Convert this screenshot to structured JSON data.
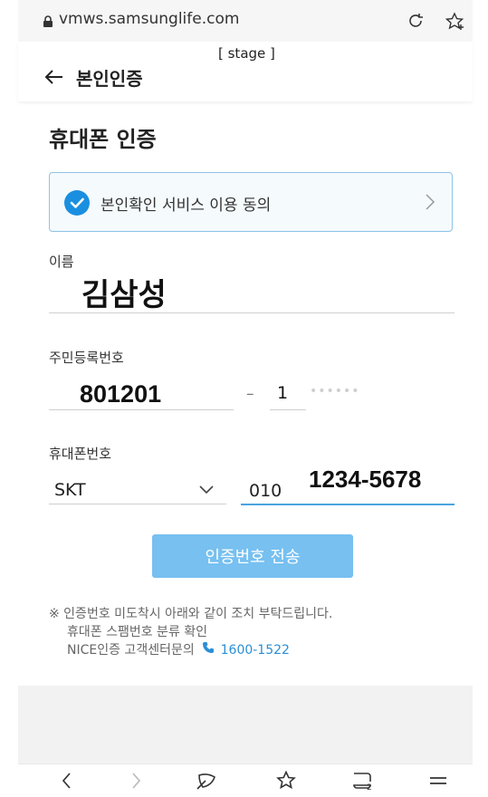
{
  "browser": {
    "url": "vmws.samsunglife.com",
    "lock_icon": "lock-icon",
    "reload_icon": "reload-icon",
    "add_favorite_icon": "star-plus-icon"
  },
  "appbar": {
    "stage_badge": "[ stage ]",
    "title": "본인인증",
    "back_icon": "back-arrow-icon"
  },
  "page": {
    "heading": "휴대폰 인증",
    "consent_label": "본인확인 서비스 이용 동의",
    "name_label": "이름",
    "name_value": "김삼성",
    "rrn_label": "주민등록번호",
    "rrn_front": "801201",
    "rrn_dash": "–",
    "rrn_back_first": "1",
    "rrn_back_mask": "••••••",
    "phone_label": "휴대폰번호",
    "carrier": "SKT",
    "phone_prefix": "010",
    "phone_number": "1234-5678",
    "send_button": "인증번호 전송",
    "notice_line1": "※ 인증번호 미도착시 아래와 같이 조치 부탁드립니다.",
    "notice_line2": "휴대폰 스팸번호 분류 확인",
    "notice_line3_prefix": "NICE인증 고객센터문의",
    "notice_phone": "1600-1522"
  },
  "colors": {
    "accent": "#1a8fe0",
    "button": "#77c0f0",
    "link": "#2b8fd6"
  },
  "bottom_nav": [
    "chevron-left-icon",
    "chevron-right-icon",
    "tab-swipe-icon",
    "star-icon",
    "tabs-count-icon",
    "menu-icon"
  ]
}
